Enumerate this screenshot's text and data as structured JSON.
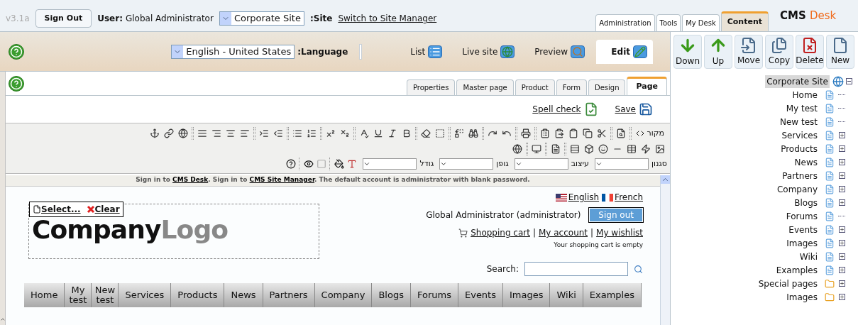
{
  "header": {
    "version": "v3.1a",
    "sign_out": "Sign Out",
    "user_label": "User:",
    "user_name": "Global Administrator",
    "site_select": "Corporate Site",
    "site_label": ":Site",
    "switch_link": "Switch to Site Manager"
  },
  "main_tabs": [
    {
      "label": "Administration",
      "selected": false
    },
    {
      "label": "Tools",
      "selected": false
    },
    {
      "label": "My Desk",
      "selected": false
    },
    {
      "label": "Content",
      "selected": true
    }
  ],
  "logo": {
    "part_1": "CMS",
    "part_2": "Desk"
  },
  "view_bar": {
    "language_select": "English - United States",
    "language_label": ":Language",
    "modes": [
      {
        "label": "List",
        "kind": "list",
        "selected": false
      },
      {
        "label": "Live site",
        "kind": "live",
        "selected": false
      },
      {
        "label": "Preview",
        "kind": "preview",
        "selected": false
      },
      {
        "label": "Edit",
        "kind": "edit",
        "selected": true
      }
    ]
  },
  "actions": [
    {
      "label": "Down",
      "kind": "down"
    },
    {
      "label": "Up",
      "kind": "up"
    },
    {
      "label": "Move",
      "kind": "move"
    },
    {
      "label": "Copy",
      "kind": "copy"
    },
    {
      "label": "Delete",
      "kind": "delete"
    },
    {
      "label": "New",
      "kind": "new"
    }
  ],
  "page_tabs": [
    {
      "label": "Properties",
      "selected": false
    },
    {
      "label": "Master page",
      "selected": false
    },
    {
      "label": "Product",
      "selected": false
    },
    {
      "label": "Form",
      "selected": false
    },
    {
      "label": "Design",
      "selected": false
    },
    {
      "label": "Page",
      "selected": true
    }
  ],
  "editor": {
    "spell_check": "Spell check",
    "save": "Save",
    "source_label": "מקור",
    "selects": [
      "סגנון",
      "עיצוב",
      "גופן",
      "גודל"
    ]
  },
  "preview": {
    "notice": {
      "text_1": "Sign in to ",
      "link_1": "CMS Desk",
      "text_2": ". Sign in to ",
      "link_2": "CMS Site Manager",
      "text_3": ". The default account is administrator with blank password."
    },
    "logo_zone": {
      "select": "Select...",
      "clear": "Clear",
      "logo_dark": "Company",
      "logo_light": "Logo"
    },
    "languages": [
      {
        "label": "English",
        "kind": "us"
      },
      {
        "label": "French",
        "kind": "fr"
      }
    ],
    "user_display": "Global Administrator (administrator)",
    "sign_out": "Sign out",
    "links": [
      "Shopping cart",
      "My account",
      "My wishlist"
    ],
    "link_separators": [
      "|",
      "|"
    ],
    "cart_status": "Your shopping cart is empty",
    "search_label": "Search:",
    "menu": [
      "Home",
      "My test",
      "New test",
      "Services",
      "Products",
      "News",
      "Partners",
      "Company",
      "Blogs",
      "Forums",
      "Events",
      "Images",
      "Wiki",
      "Examples"
    ]
  },
  "tree": {
    "label": "Corporate Site",
    "selected": true,
    "expanded": true,
    "children": [
      {
        "label": "Home",
        "kind": "page",
        "expandable": false
      },
      {
        "label": "My test",
        "kind": "page",
        "expandable": false
      },
      {
        "label": "New test",
        "kind": "page",
        "expandable": false
      },
      {
        "label": "Services",
        "kind": "page",
        "expandable": true
      },
      {
        "label": "Products",
        "kind": "page",
        "expandable": true
      },
      {
        "label": "News",
        "kind": "page",
        "expandable": true
      },
      {
        "label": "Partners",
        "kind": "page",
        "expandable": true
      },
      {
        "label": "Company",
        "kind": "page",
        "expandable": true
      },
      {
        "label": "Blogs",
        "kind": "page",
        "expandable": true
      },
      {
        "label": "Forums",
        "kind": "page",
        "expandable": false
      },
      {
        "label": "Events",
        "kind": "page",
        "expandable": true
      },
      {
        "label": "Images",
        "kind": "page",
        "expandable": true
      },
      {
        "label": "Wiki",
        "kind": "page",
        "expandable": true
      },
      {
        "label": "Examples",
        "kind": "page",
        "expandable": true
      },
      {
        "label": "Special pages",
        "kind": "folder",
        "expandable": true
      },
      {
        "label": "Images",
        "kind": "folder",
        "expandable": true
      }
    ]
  }
}
